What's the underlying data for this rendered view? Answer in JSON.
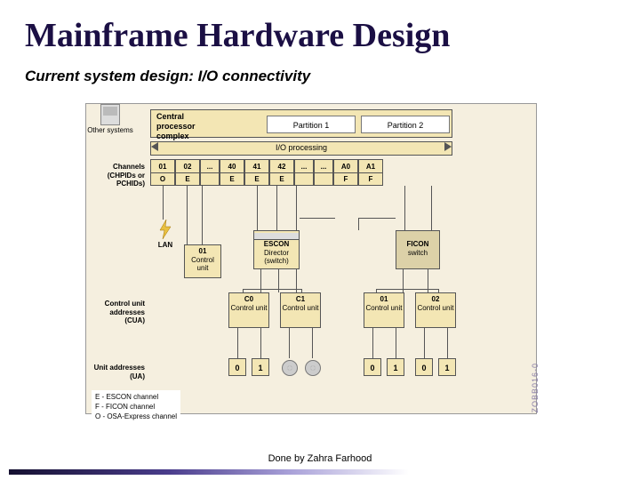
{
  "title": "Mainframe Hardware Design",
  "subtitle": "Current  system design: I/O connectivity",
  "cpc_label_l1": "Central",
  "cpc_label_l2": "processor",
  "cpc_label_l3": "complex",
  "partition1": "Partition 1",
  "partition2": "Partition 2",
  "io_label": "I/O processing",
  "left_labels": {
    "channels_l1": "Channels",
    "channels_l2": "(CHPIDs or",
    "channels_l3": "PCHIDs)",
    "cu_l1": "Control unit",
    "cu_l2": "addresses",
    "cu_l3": "(CUA)",
    "ua_l1": "Unit addresses",
    "ua_l2": "(UA)"
  },
  "channels": [
    {
      "num": "01",
      "typ": "O"
    },
    {
      "num": "02",
      "typ": "E"
    },
    {
      "num": "...",
      "typ": ""
    },
    {
      "num": "40",
      "typ": "E"
    },
    {
      "num": "41",
      "typ": "E"
    },
    {
      "num": "42",
      "typ": "E"
    },
    {
      "num": "...",
      "typ": ""
    },
    {
      "num": "...",
      "typ": ""
    },
    {
      "num": "A0",
      "typ": "F"
    },
    {
      "num": "A1",
      "typ": "F"
    }
  ],
  "lan": "LAN",
  "units": {
    "u01_num": "01",
    "u01_txt": "Control unit",
    "escon_l1": "ESCON",
    "escon_l2": "Director",
    "escon_l3": "(switch)",
    "ficon_l1": "FICON",
    "ficon_l2": "switch",
    "other": "Other systems"
  },
  "control_units": {
    "c0_num": "C0",
    "c0_txt": "Control unit",
    "c1_num": "C1",
    "c1_txt": "Control unit",
    "u01_num": "01",
    "u01_txt": "Control unit",
    "u02_num": "02",
    "u02_txt": "Control unit"
  },
  "ua": {
    "v0": "0",
    "v1": "1"
  },
  "legend": {
    "e": "E - ESCON channel",
    "f": "F - FICON channel",
    "o": "O - OSA-Express channel"
  },
  "side_code": "ZOBB016-0",
  "footer": "Done by Zahra Farhood"
}
